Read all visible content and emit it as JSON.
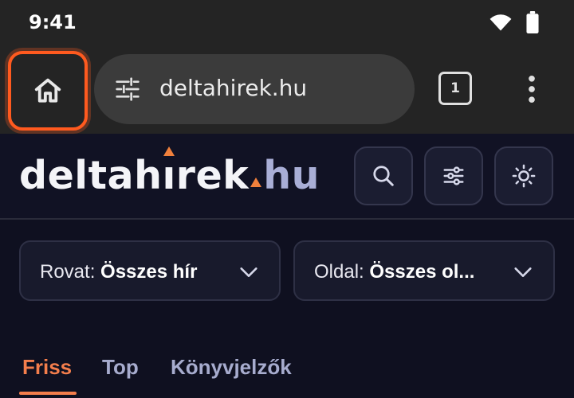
{
  "status": {
    "time": "9:41"
  },
  "browser": {
    "url": "deltahirek.hu",
    "tab_count": "1"
  },
  "site": {
    "logo_main": "deltah",
    "logo_i": "ı",
    "logo_rest": "rek",
    "logo_tld": "hu"
  },
  "filters": {
    "rovat_label": "Rovat: ",
    "rovat_value": "Összes hír",
    "oldal_label": "Oldal: ",
    "oldal_value": "Összes ol..."
  },
  "tabs": [
    {
      "label": "Friss",
      "active": true
    },
    {
      "label": "Top",
      "active": false
    },
    {
      "label": "Könyvjelzők",
      "active": false
    }
  ],
  "icons": {
    "home": "home-icon",
    "tune": "tune-icon",
    "menu": "more-vert-icon",
    "search": "search-icon",
    "filter": "sliders-icon",
    "theme": "sun-icon"
  },
  "colors": {
    "accent": "#f47e4c",
    "highlight": "#ff5a1f",
    "background": "#0f1020"
  }
}
